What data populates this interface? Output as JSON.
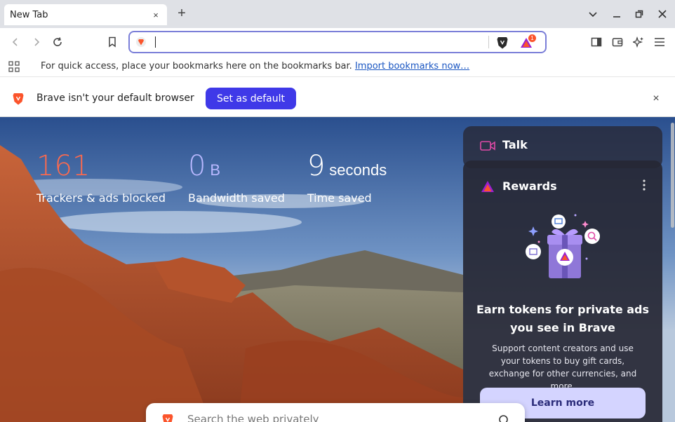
{
  "tabs": [
    {
      "title": "New Tab",
      "close": "×"
    }
  ],
  "new_tab_symbol": "+",
  "omnibox": {
    "value": "",
    "shields_badge": "1"
  },
  "bookmarks_bar": {
    "message": "For quick access, place your bookmarks here on the bookmarks bar.",
    "link": "Import bookmarks now…"
  },
  "infobar": {
    "message": "Brave isn't your default browser",
    "button": "Set as default",
    "close": "×"
  },
  "stats": [
    {
      "value": "161",
      "unit": "",
      "label": "Trackers & ads blocked",
      "color": "#ff6a4d"
    },
    {
      "value": "0",
      "unit": "B",
      "label": "Bandwidth saved",
      "color": "#b9b8ff"
    },
    {
      "value": "9",
      "unit": "seconds",
      "label": "Time saved",
      "color": "#ffffff"
    }
  ],
  "widgets": {
    "talk": {
      "title": "Talk"
    },
    "rewards": {
      "title": "Rewards",
      "heading": "Earn tokens for private ads you see in Brave",
      "body": "Support content creators and use your tokens to buy gift cards, exchange for other currencies, and more.",
      "button": "Learn more"
    }
  },
  "search": {
    "placeholder": "Search the web privately"
  },
  "colors": {
    "accent": "#3f39e8",
    "omnibox_border": "#7b7fd8",
    "brave_orange": "#fb542b"
  }
}
